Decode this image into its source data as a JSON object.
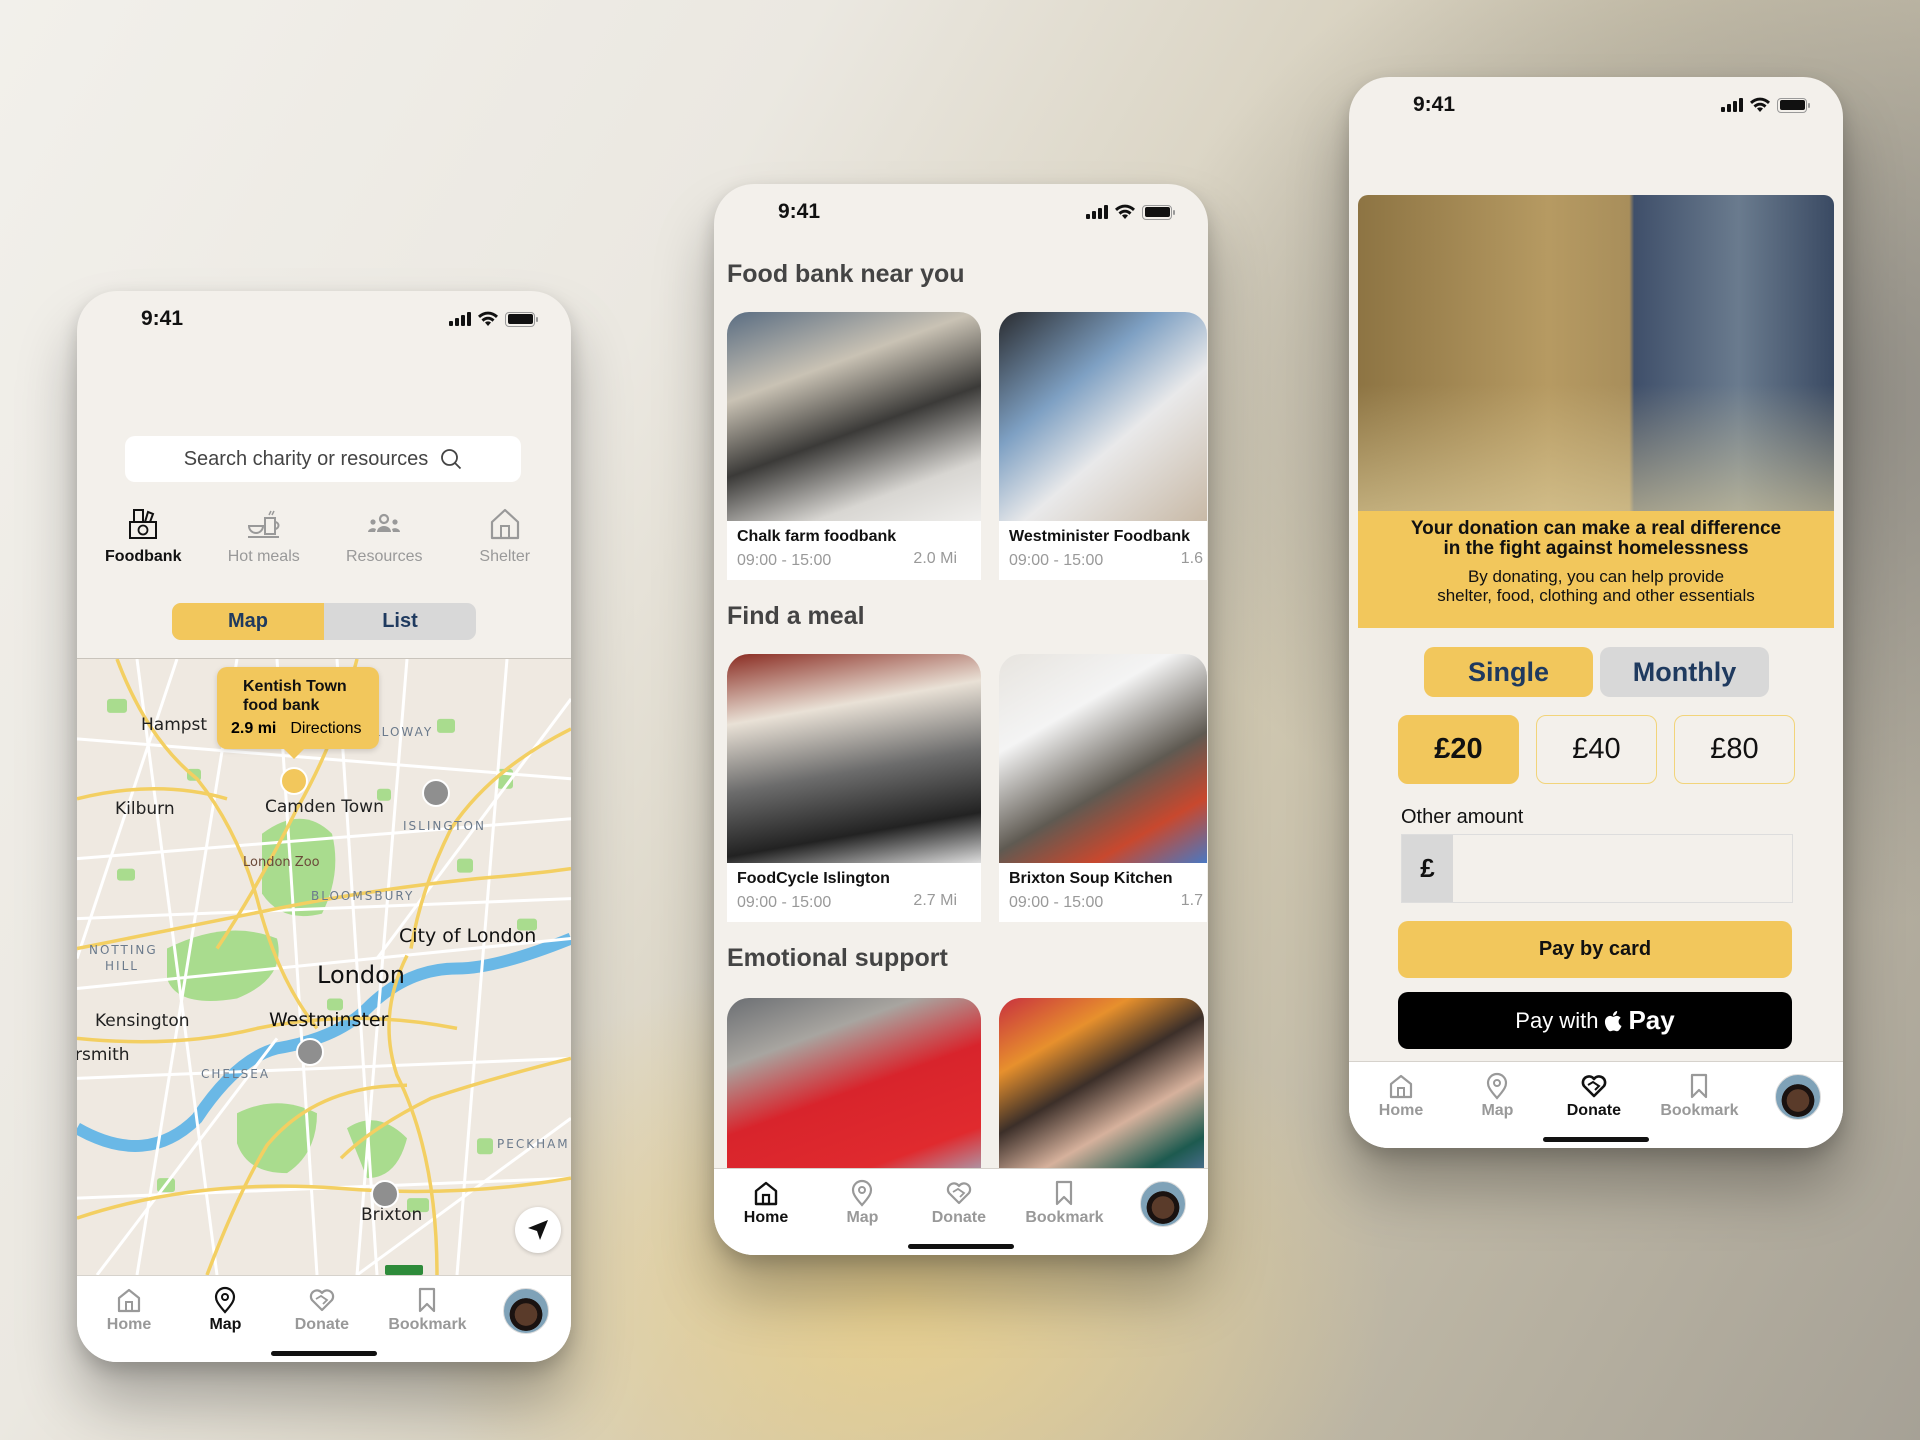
{
  "status_bar": {
    "time": "9:41"
  },
  "colors": {
    "accent": "#f2c75c",
    "segment_text": "#1f3a5f",
    "inactive": "#d8d8d8",
    "screen_bg": "#f3f0eb"
  },
  "map_screen": {
    "search": {
      "placeholder": "Search charity or resources",
      "icon": "search-icon"
    },
    "categories": [
      {
        "label": "Foodbank",
        "icon": "foodbank-icon",
        "active": true
      },
      {
        "label": "Hot meals",
        "icon": "hot-meal-icon",
        "active": false
      },
      {
        "label": "Resources",
        "icon": "people-icon",
        "active": false
      },
      {
        "label": "Shelter",
        "icon": "house-icon",
        "active": false
      }
    ],
    "view_toggle": {
      "options": [
        "Map",
        "List"
      ],
      "selected": "Map"
    },
    "map": {
      "labels": {
        "hampstead": "Hampst",
        "holloway": "LLOWAY",
        "kilburn": "Kilburn",
        "camden": "Camden Town",
        "islington": "ISLINGTON",
        "zoo": "London Zoo",
        "bloomsbury": "BLOOMSBURY",
        "notting": "NOTTING",
        "hill": "HILL",
        "city": "City of London",
        "london": "London",
        "kensington": "Kensington",
        "westminster": "Westminster",
        "hammersmith": "rsmith",
        "chelsea": "CHELSEA",
        "peckham": "PECKHAM",
        "brixton": "Brixton"
      },
      "callout": {
        "title_line1": "Kentish Town",
        "title_line2": "food bank",
        "distance": "2.9 mi",
        "action": "Directions"
      }
    },
    "tabbar": {
      "items": [
        {
          "label": "Home",
          "icon": "home-icon"
        },
        {
          "label": "Map",
          "icon": "map-pin-icon"
        },
        {
          "label": "Donate",
          "icon": "heart-hand-icon"
        },
        {
          "label": "Bookmark",
          "icon": "bookmark-icon"
        }
      ],
      "active": "Map"
    }
  },
  "home_screen": {
    "sections": [
      {
        "title": "Food bank near you",
        "cards": [
          {
            "name": "Chalk farm foodbank",
            "hours": "09:00 - 15:00",
            "distance": "2.0 Mi"
          },
          {
            "name": "Westminister Foodbank",
            "hours": "09:00 - 15:00",
            "distance": "1.6"
          }
        ]
      },
      {
        "title": "Find a meal",
        "cards": [
          {
            "name": "FoodCycle Islington",
            "hours": "09:00 - 15:00",
            "distance": "2.7 Mi"
          },
          {
            "name": "Brixton Soup Kitchen",
            "hours": "09:00 - 15:00",
            "distance": "1.7"
          }
        ]
      },
      {
        "title": "Emotional support",
        "cards": [
          {
            "name": "",
            "hours": "",
            "distance": ""
          },
          {
            "name": "",
            "hours": "",
            "distance": ""
          }
        ]
      }
    ],
    "tabbar": {
      "items": [
        {
          "label": "Home"
        },
        {
          "label": "Map"
        },
        {
          "label": "Donate"
        },
        {
          "label": "Bookmark"
        }
      ],
      "active": "Home"
    }
  },
  "donate_screen": {
    "banner": {
      "headline_line1": "Your donation can make a real difference",
      "headline_line2": "in the fight against homelessness",
      "sub_line1": "By donating, you can help provide",
      "sub_line2": "shelter, food, clothing and other essentials"
    },
    "frequency": {
      "options": [
        "Single",
        "Monthly"
      ],
      "selected": "Single"
    },
    "amounts": {
      "options": [
        "£20",
        "£40",
        "£80"
      ],
      "selected": "£20"
    },
    "other_amount": {
      "label": "Other amount",
      "currency": "£",
      "value": ""
    },
    "pay_card": "Pay by card",
    "pay_apple_prefix": "Pay with",
    "pay_apple_brand": "Pay",
    "tabbar": {
      "items": [
        {
          "label": "Home"
        },
        {
          "label": "Map"
        },
        {
          "label": "Donate"
        },
        {
          "label": "Bookmark"
        }
      ],
      "active": "Donate"
    }
  }
}
